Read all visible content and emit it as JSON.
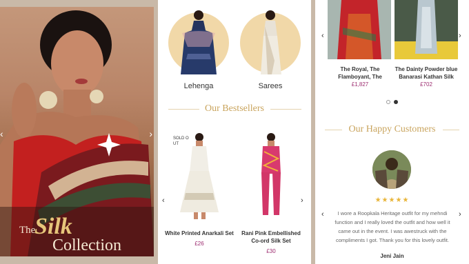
{
  "hero": {
    "title_the": "The",
    "title_silk": "Silk",
    "title_collection": "Collection",
    "prev_icon": "chevron-left",
    "next_icon": "chevron-right"
  },
  "categories": [
    {
      "label": "Lehenga"
    },
    {
      "label": "Sarees"
    }
  ],
  "bestsellers": {
    "title": "Our Bestsellers",
    "sold_out": "SOLD O\nUT",
    "products": [
      {
        "name": "White Printed Anarkali Set",
        "price": "£26"
      },
      {
        "name": "Rani Pink Embellished Co-ord Silk Set",
        "price": "£30"
      }
    ]
  },
  "featured": {
    "products": [
      {
        "name": "The Royal, The Flamboyant, The",
        "price": "£1,827"
      },
      {
        "name": "The Dainty Powder blue Banarasi Kathan Silk",
        "price": "£702"
      }
    ]
  },
  "testimonials": {
    "title": "Our Happy Customers",
    "stars": "★★★★★",
    "review": "I wore a Roopkala Heritage outfit for my mehndi function and I really loved the outfit and how well it came out in the event. I was awestruck with the compliments I got. Thank you for this lovely outfit.",
    "reviewer": "Jeni Jain"
  },
  "colors": {
    "accent_gold": "#c9a45d",
    "price_magenta": "#9c2b6f",
    "circle_bg": "#f1d8a8",
    "star": "#e8b53a"
  }
}
